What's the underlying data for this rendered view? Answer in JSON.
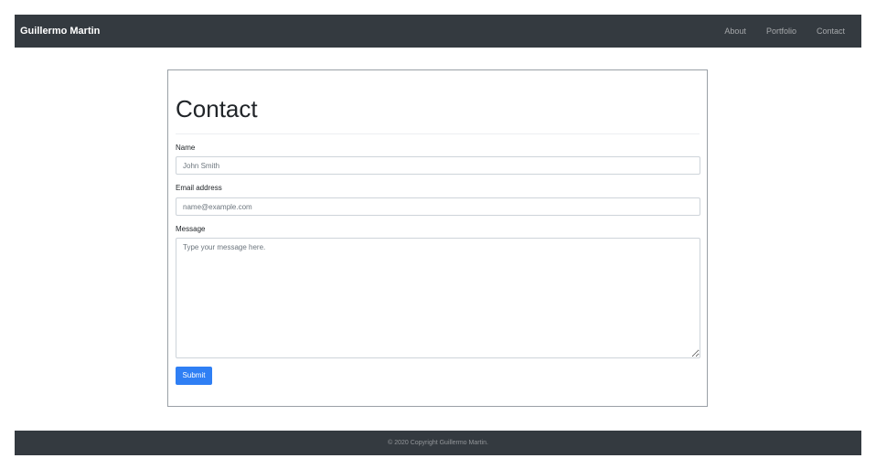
{
  "navbar": {
    "brand": "Guillermo Martin",
    "links": [
      {
        "label": "About"
      },
      {
        "label": "Portfolio"
      },
      {
        "label": "Contact"
      }
    ]
  },
  "contact_form": {
    "title": "Contact",
    "name": {
      "label": "Name",
      "value": "",
      "placeholder": "John Smith"
    },
    "email": {
      "label": "Email address",
      "value": "",
      "placeholder": "name@example.com"
    },
    "message": {
      "label": "Message",
      "value": "",
      "placeholder": "Type your message here."
    },
    "submit_label": "Submit"
  },
  "footer": {
    "copyright": "© 2020 Copyright Guillermo Martin."
  },
  "colors": {
    "navbar_bg": "#343a40",
    "primary_button": "#2f7ff4"
  }
}
